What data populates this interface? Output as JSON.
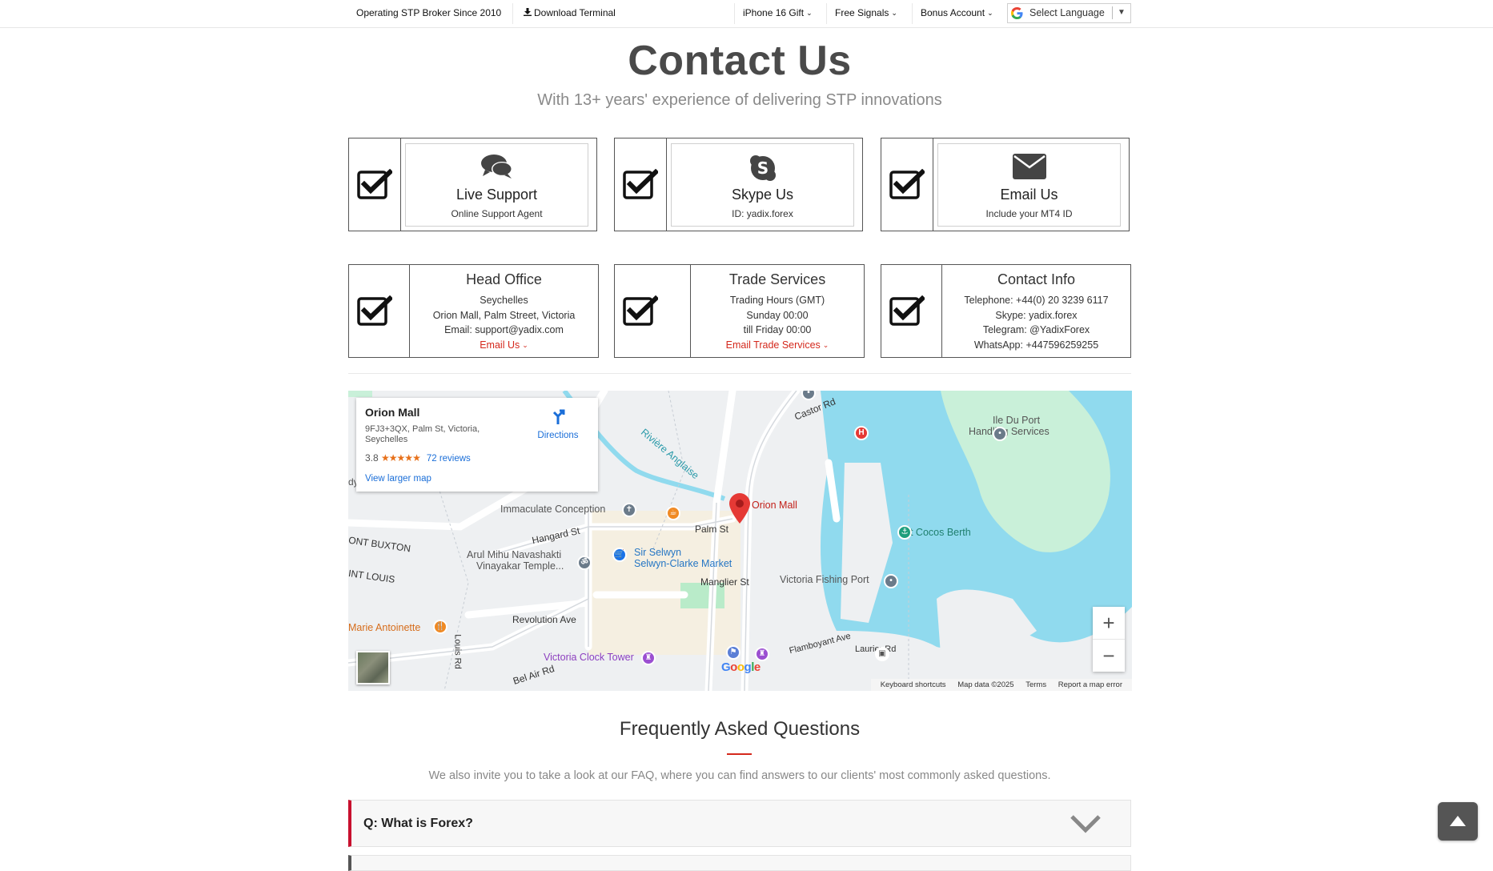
{
  "topbar": {
    "tagline": "Operating STP Broker Since 2010",
    "download": "Download Terminal",
    "iphone": "iPhone 16 Gift",
    "signals": "Free Signals",
    "bonus": "Bonus Account",
    "language": "Select Language"
  },
  "header": {
    "title": "Contact Us",
    "subtitle": "With 13+ years' experience of delivering STP innovations"
  },
  "cards_top": [
    {
      "title": "Live Support",
      "sub": "Online Support Agent",
      "icon": "chat-icon"
    },
    {
      "title": "Skype Us",
      "sub": "ID: yadix.forex",
      "icon": "skype-icon"
    },
    {
      "title": "Email Us",
      "sub": "Include your MT4 ID",
      "icon": "envelope-icon"
    }
  ],
  "cards_bottom": [
    {
      "title": "Head Office",
      "lines": [
        "Seychelles",
        "Orion Mall, Palm Street, Victoria",
        "Email: support@yadix.com"
      ],
      "link": "Email Us"
    },
    {
      "title": "Trade Services",
      "lines": [
        "Trading Hours (GMT)",
        "Sunday 00:00",
        "till Friday 00:00"
      ],
      "link": "Email Trade Services"
    },
    {
      "title": "Contact Info",
      "lines": [
        "Telephone: +44(0) 20 3239 6117",
        "Skype: yadix.forex",
        "Telegram: @YadixForex",
        "WhatsApp: +447596259255"
      ],
      "link": ""
    }
  ],
  "map": {
    "place_name": "Orion Mall",
    "address": "9FJ3+3QX, Palm St, Victoria, Seychelles",
    "rating": "3.8",
    "stars": "★★★★★",
    "reviews": "72 reviews",
    "view_larger": "View larger map",
    "directions": "Directions",
    "labels": {
      "orion": "Orion Mall",
      "immaculate": "Immaculate Conception",
      "palm": "Palm St",
      "hangard": "Hangard St",
      "arul1": "Arul Mihu Navashakti",
      "arul2": "Vinayakar Temple...",
      "selwyn1": "Sir Selwyn",
      "selwyn2": "Selwyn-Clarke Market",
      "manglier": "Manglier St",
      "fishing": "Victoria Fishing Port",
      "cocos": "Cat Cocos Berth",
      "ile1": "Ile Du Port",
      "ile2": "Handling Services",
      "revolution": "Revolution Ave",
      "clock": "Victoria Clock Tower",
      "marie": "Marie Antoinette",
      "buxton": "ONT BUXTON",
      "louis": "INT LOUIS",
      "castor": "Castor Rd",
      "riviere": "Rivière Anglaise",
      "belair": "Bel Air Rd",
      "laurier": "Laurier Rd",
      "flamboyant": "Flamboyant Ave",
      "louisrd": "Louis Rd",
      "bydy": "dy By Ro",
      "google": "Google"
    },
    "zoom_in": "+",
    "zoom_out": "−",
    "attrib": [
      "Keyboard shortcuts",
      "Map data ©2025",
      "Terms",
      "Report a map error"
    ]
  },
  "faq": {
    "title": "Frequently Asked Questions",
    "desc": "We also invite you to take a look at our FAQ, where you can find answers to our clients' most commonly asked questions.",
    "items": [
      {
        "q": "Q: What is Forex?"
      }
    ]
  },
  "colors": {
    "accent": "#d4281c",
    "heading": "#4a4a4a",
    "link": "#1a6ed8"
  }
}
